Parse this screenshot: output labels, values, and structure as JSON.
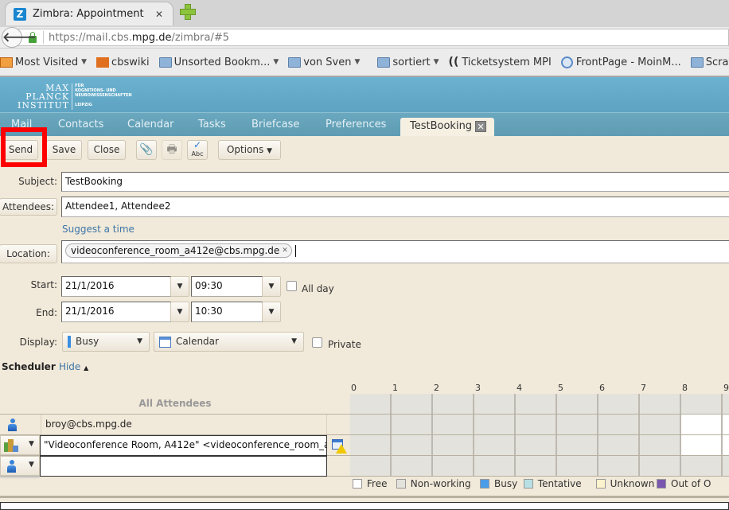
{
  "browser": {
    "tab_title": "Zimbra: Appointment",
    "url_prefix": "https://mail.cbs.",
    "url_domain": "mpg.de",
    "url_suffix": "/zimbra/#5",
    "bookmarks": [
      {
        "label": "Most Visited",
        "icon": "most-visited-icon",
        "dropdown": true
      },
      {
        "label": "cbswiki",
        "icon": "palm-icon",
        "dropdown": false
      },
      {
        "label": "Unsorted Bookm...",
        "icon": "folder-icon",
        "dropdown": true
      },
      {
        "label": "von Sven",
        "icon": "folder-icon",
        "dropdown": true
      },
      {
        "label": "sortiert",
        "icon": "folder-icon",
        "dropdown": true
      },
      {
        "label": "Ticketsystem MPI",
        "icon": "ticket-icon",
        "dropdown": false
      },
      {
        "label": "FrontPage - MoinM...",
        "icon": "moin-icon",
        "dropdown": false
      },
      {
        "label": "Scratc",
        "icon": "folder-icon",
        "dropdown": false
      }
    ]
  },
  "logo": {
    "line1": "MAX",
    "line2": "PLANCK",
    "line3": "INSTITUT",
    "sub1": "FÜR",
    "sub2": "KOGNITIONS- UND",
    "sub3": "NEUROWISSENSCHAFTEN",
    "sub4": "LEIPZIG"
  },
  "app_tabs": [
    "Mail",
    "Contacts",
    "Calendar",
    "Tasks",
    "Briefcase",
    "Preferences"
  ],
  "active_tab": "TestBooking",
  "toolbar": {
    "send": "Send",
    "save": "Save",
    "close": "Close",
    "options": "Options"
  },
  "form": {
    "subject_label": "Subject:",
    "subject_value": "TestBooking",
    "attendees_label": "Attendees:",
    "attendees_value": "Attendee1, Attendee2",
    "suggest_link": "Suggest a time",
    "location_label": "Location:",
    "location_value": "videoconference_room_a412e@cbs.mpg.de",
    "start_label": "Start:",
    "start_date": "21/1/2016",
    "start_time": "09:30",
    "allday_label": "All day",
    "allday_checked": false,
    "end_label": "End:",
    "end_date": "21/1/2016",
    "end_time": "10:30",
    "display_label": "Display:",
    "display_value": "Busy",
    "calendar_value": "Calendar",
    "private_label": "Private",
    "private_checked": false
  },
  "scheduler": {
    "title": "Scheduler",
    "hide_link": "Hide",
    "all_attendees": "All Attendees",
    "hours": [
      "0",
      "1",
      "2",
      "3",
      "4",
      "5",
      "6",
      "7",
      "8",
      "9"
    ],
    "attendees": [
      {
        "name": "broy@cbs.mpg.de",
        "type": "person"
      },
      {
        "name": "\"Videoconference Room, A412e\" <videoconference_room_a",
        "type": "location"
      },
      {
        "name": "",
        "type": "person"
      }
    ],
    "legend": [
      {
        "label": "Free",
        "color": "#ffffff"
      },
      {
        "label": "Non-working",
        "color": "#e3e2dc"
      },
      {
        "label": "Busy",
        "color": "#4a9be8"
      },
      {
        "label": "Tentative",
        "color": "#b8e0e4"
      },
      {
        "label": "Unknown",
        "color": "#fcf3cc"
      },
      {
        "label": "Out of O",
        "color": "#7a58b0"
      }
    ]
  },
  "colors": {
    "header": "#6bb2d0",
    "background": "#f1e9d9",
    "highlight": "#ff0000",
    "link": "#3d76a8"
  }
}
